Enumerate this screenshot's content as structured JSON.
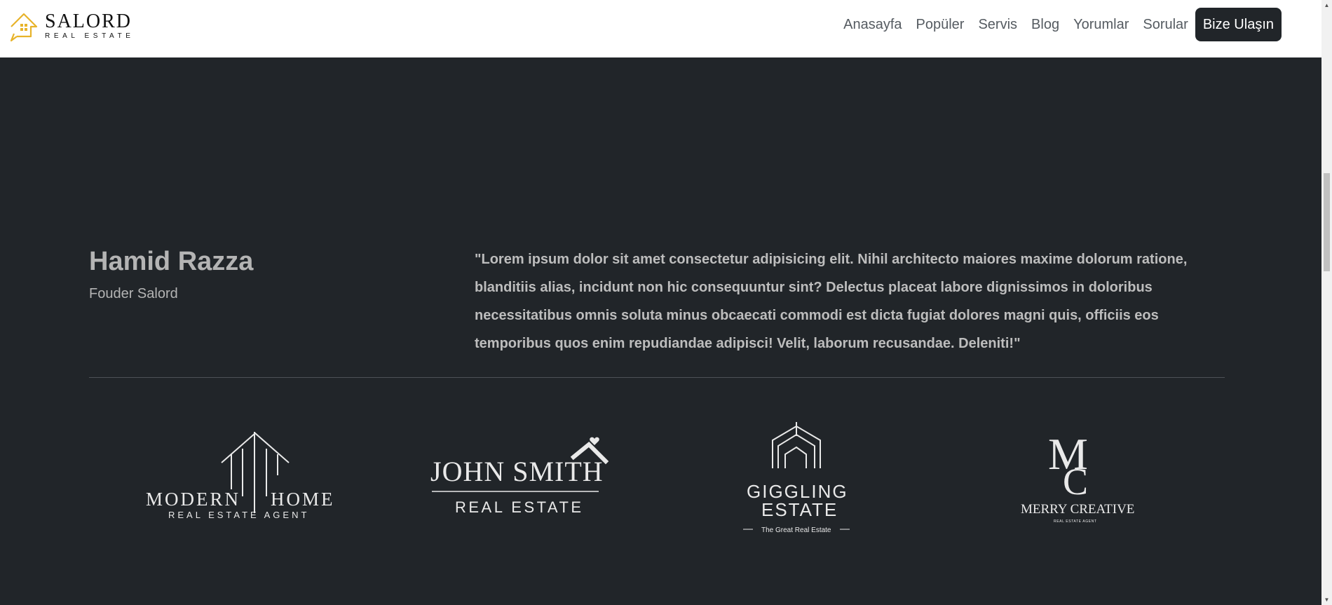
{
  "brand": {
    "title": "SALORD",
    "subtitle": "REAL ESTATE",
    "accent": "#e7b32a",
    "icon": "house-icon"
  },
  "nav": {
    "links": [
      "Anasayfa",
      "Popüler",
      "Servis",
      "Blog",
      "Yorumlar",
      "Sorular"
    ],
    "cta": "Bize Ulaşın"
  },
  "testimonial": {
    "name": "Hamid Razza",
    "role": "Fouder Salord",
    "quote": "\"Lorem ipsum dolor sit amet consectetur adipisicing elit. Nihil architecto maiores maxime dolorum ratione, blanditiis alias, incidunt non hic consequuntur sint? Delectus placeat labore dignissimos in doloribus necessitatibus omnis soluta minus obcaecati commodi est dicta fugiat dolores magni quis, officiis eos temporibus quos enim repudiandae adipisci! Velit, laborum recusandae. Deleniti!\""
  },
  "logos": {
    "modern_home": {
      "line1_left": "MODERN",
      "line1_right": "HOME",
      "line2": "REAL ESTATE AGENT"
    },
    "john_smith": {
      "line1": "JOHN SMITH",
      "line2": "REAL ESTATE"
    },
    "giggling": {
      "line1": "GIGGLING",
      "line2": "ESTATE",
      "tagline": "The Great Real Estate"
    },
    "merry": {
      "monogram_top": "M",
      "monogram_bottom": "C",
      "line1": "MERRY CREATIVE",
      "line2": "REAL ESTATE AGENT"
    }
  },
  "colors": {
    "background": "#212529",
    "navbar": "#ffffff",
    "logo_ink": "#e9e9e9"
  }
}
